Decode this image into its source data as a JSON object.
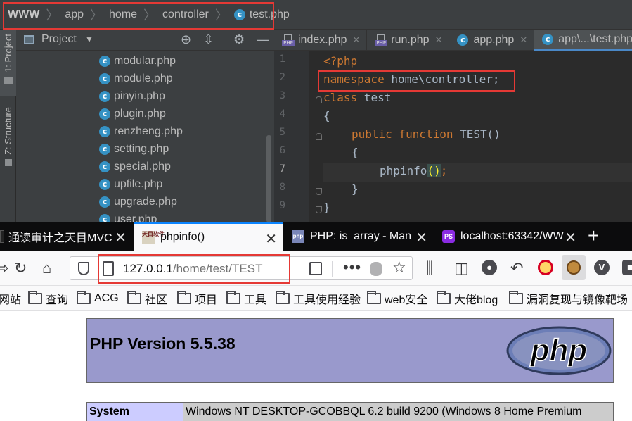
{
  "ide": {
    "breadcrumbs": [
      "WWW",
      "app",
      "home",
      "controller",
      "test.php"
    ],
    "side_tabs": [
      "1: Project",
      "Z: Structure"
    ],
    "project_panel": {
      "title": "Project",
      "files": [
        "modular.php",
        "module.php",
        "pinyin.php",
        "plugin.php",
        "renzheng.php",
        "setting.php",
        "special.php",
        "upfile.php",
        "upgrade.php",
        "user.php"
      ]
    },
    "tabs": [
      "index.php",
      "run.php",
      "app.php",
      "app\\...\\test.php"
    ],
    "line_numbers": [
      "1",
      "2",
      "3",
      "4",
      "5",
      "6",
      "7",
      "8",
      "9"
    ],
    "code": {
      "l1": "<?php",
      "l2_kw": "namespace",
      "l2_rest": " home\\controller;",
      "l3_kw": "class",
      "l3_rest": " test",
      "l4": "{",
      "l5_kw": "public function",
      "l5_name": " TEST",
      "l5_paren": "()",
      "l6": "{",
      "l7_fn": "phpinfo",
      "l7_open": "(",
      "l7_close": ")",
      "l7_semi": ";",
      "l8": "}",
      "l9": "}"
    }
  },
  "browser": {
    "tabs": [
      {
        "title": "通读审计之天目MVC"
      },
      {
        "title": "phpinfo()",
        "icon_text": "天目软件"
      },
      {
        "title": "PHP: is_array - Man",
        "icon_text": "php"
      },
      {
        "title": "localhost:63342/WW",
        "icon_text": "PS"
      }
    ],
    "new_tab": "+",
    "url": {
      "host": "127.0.0.1",
      "path": "/home/test/TEST"
    },
    "bookmarks": [
      "网站",
      "查询",
      "ACG",
      "社区",
      "项目",
      "工具",
      "工具使用经验",
      "web安全",
      "大佬blog",
      "漏洞复现与镜像靶场"
    ],
    "page": {
      "title": "PHP Version 5.5.38",
      "logo_text": "php",
      "row_label": "System",
      "row_value": "Windows NT DESKTOP-GCOBBQL 6.2 build 9200 (Windows 8 Home Premium"
    }
  },
  "colors": {
    "highlight_box": "#e53935",
    "php_header": "#9999cc",
    "keyword": "#cc7832",
    "function": "#ffc66d"
  }
}
